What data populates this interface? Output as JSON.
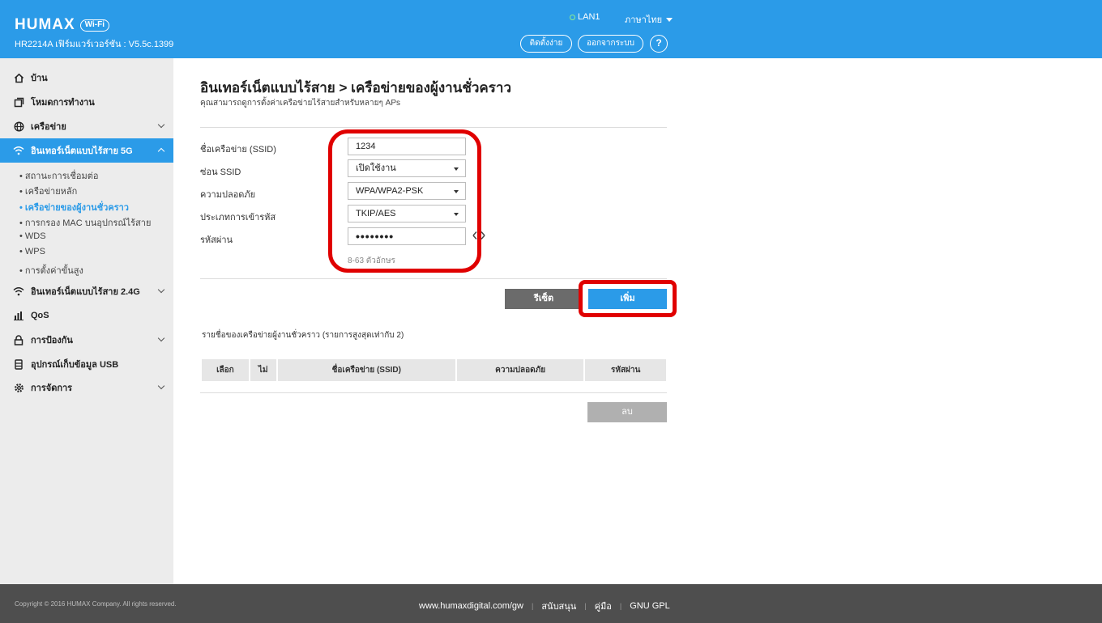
{
  "header": {
    "brand": "HUMAX",
    "brand_badge": "Wi-Fi",
    "firmware": "HR2214A เฟิร์มแวร์เวอร์ชัน : V5.5c.1399",
    "lan_label": "LAN1",
    "language": "ภาษาไทย",
    "setup_button": "ติดตั้งง่าย",
    "logout_button": "ออกจากระบบ",
    "help": "?"
  },
  "sidebar": {
    "items": [
      {
        "label": "บ้าน",
        "icon": "home-icon"
      },
      {
        "label": "โหมดการทำงาน",
        "icon": "copy-icon"
      },
      {
        "label": "เครือข่าย",
        "icon": "globe-icon"
      },
      {
        "label": "อินเทอร์เน็ตแบบไร้สาย 5G",
        "icon": "wifi-icon"
      },
      {
        "label": "อินเทอร์เน็ตแบบไร้สาย 2.4G",
        "icon": "wifi-icon"
      },
      {
        "label": "QoS",
        "icon": "bar-chart-icon"
      },
      {
        "label": "การป้องกัน",
        "icon": "lock-icon"
      },
      {
        "label": "อุปกรณ์เก็บข้อมูล USB",
        "icon": "usb-storage-icon"
      },
      {
        "label": "การจัดการ",
        "icon": "gear-icon"
      }
    ],
    "subitems": [
      "• สถานะการเชื่อมต่อ",
      "• เครือข่ายหลัก",
      "• เครือข่ายของผู้งานชั่วคราว",
      "• การกรอง MAC บนอุปกรณ์ไร้สาย",
      "• WDS",
      "• WPS",
      "• การตั้งค่าขั้นสูง"
    ]
  },
  "main": {
    "title": "อินเทอร์เน็ตแบบไร้สาย > เครือข่ายของผู้งานชั่วคราว",
    "description": "คุณสามารถดูการตั้งค่าเครือข่ายไร้สายสำหรับหลายๆ APs",
    "form": {
      "ssid_label": "ชื่อเครือข่าย (SSID)",
      "ssid_value": "1234",
      "hide_ssid_label": "ซ่อน SSID",
      "hide_ssid_value": "เปิดใช้งาน",
      "security_label": "ความปลอดภัย",
      "security_value": "WPA/WPA2-PSK",
      "encryption_label": "ประเภทการเข้ารหัส",
      "encryption_value": "TKIP/AES",
      "password_label": "รหัสผ่าน",
      "password_value": "••••••••",
      "password_hint": "8-63 ตัวอักษร"
    },
    "reset_button": "รีเซ็ต",
    "add_button": "เพิ่ม",
    "list_title": "รายชื่อของเครือข่ายผู้งานชั่วคราว  (รายการสูงสุดเท่ากับ 2)",
    "table_headers": [
      "เลือก",
      "ไม่",
      "ชื่อเครือข่าย (SSID)",
      "ความปลอดภัย",
      "รหัสผ่าน"
    ],
    "delete_button": "ลบ"
  },
  "footer": {
    "copyright": "Copyright © 2016 HUMAX Company. All rights reserved.",
    "links": [
      "www.humaxdigital.com/gw",
      "สนับสนุน",
      "คู่มือ",
      "GNU GPL"
    ]
  },
  "colors": {
    "primary": "#2b9be8",
    "highlight": "#e00000",
    "footer_bg": "#4e4e4e",
    "sidebar_bg": "#ececec"
  }
}
